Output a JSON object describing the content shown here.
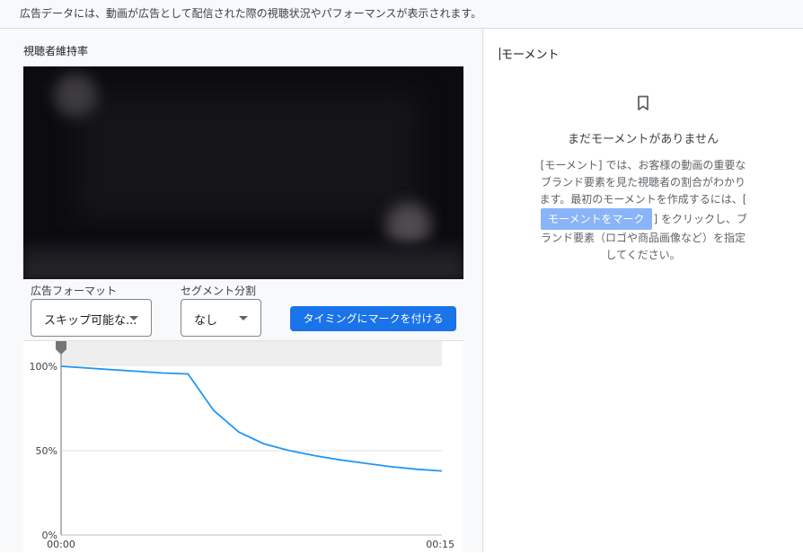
{
  "notice": {
    "text": "広告データには、動画が広告として配信された際の視聴状況やパフォーマンスが表示されます。"
  },
  "retention": {
    "title": "視聴者維持率",
    "format_label": "広告フォーマット",
    "format_value": "スキップ可能な...",
    "segment_label": "セグメント分割",
    "segment_value": "なし",
    "mark_button_label": "タイミングにマークを付ける"
  },
  "moments": {
    "title": "モーメント",
    "bookmark_icon": "bookmark-icon",
    "empty_heading": "まだモーメントがありません",
    "desc_before": "[モーメント] では、お客様の動画の重要なブランド要素を見た視聴者の割合がわかります。最初のモーメントを作成するには、[",
    "desc_chip": "モーメントをマーク",
    "desc_after": "] をクリックし、ブランド要素（ロゴや商品画像など）を指定してください。"
  },
  "chart_data": {
    "type": "line",
    "x_tick_labels": [
      "00:00",
      "00:15"
    ],
    "y_tick_labels": [
      "100%",
      "50%",
      "0%"
    ],
    "xlim": [
      0,
      15
    ],
    "ylim": [
      0,
      100
    ],
    "series": [
      {
        "color": "#2196f3",
        "x": [
          0,
          1,
          2,
          3,
          4,
          5,
          6,
          7,
          8,
          9,
          10,
          11,
          12,
          13,
          14,
          15
        ],
        "y": [
          100,
          99,
          98,
          97,
          96,
          95.5,
          74,
          61,
          54,
          50,
          47,
          44.5,
          42.5,
          40.5,
          39,
          38
        ]
      }
    ],
    "grid": true,
    "line_color": "#2196f3"
  }
}
